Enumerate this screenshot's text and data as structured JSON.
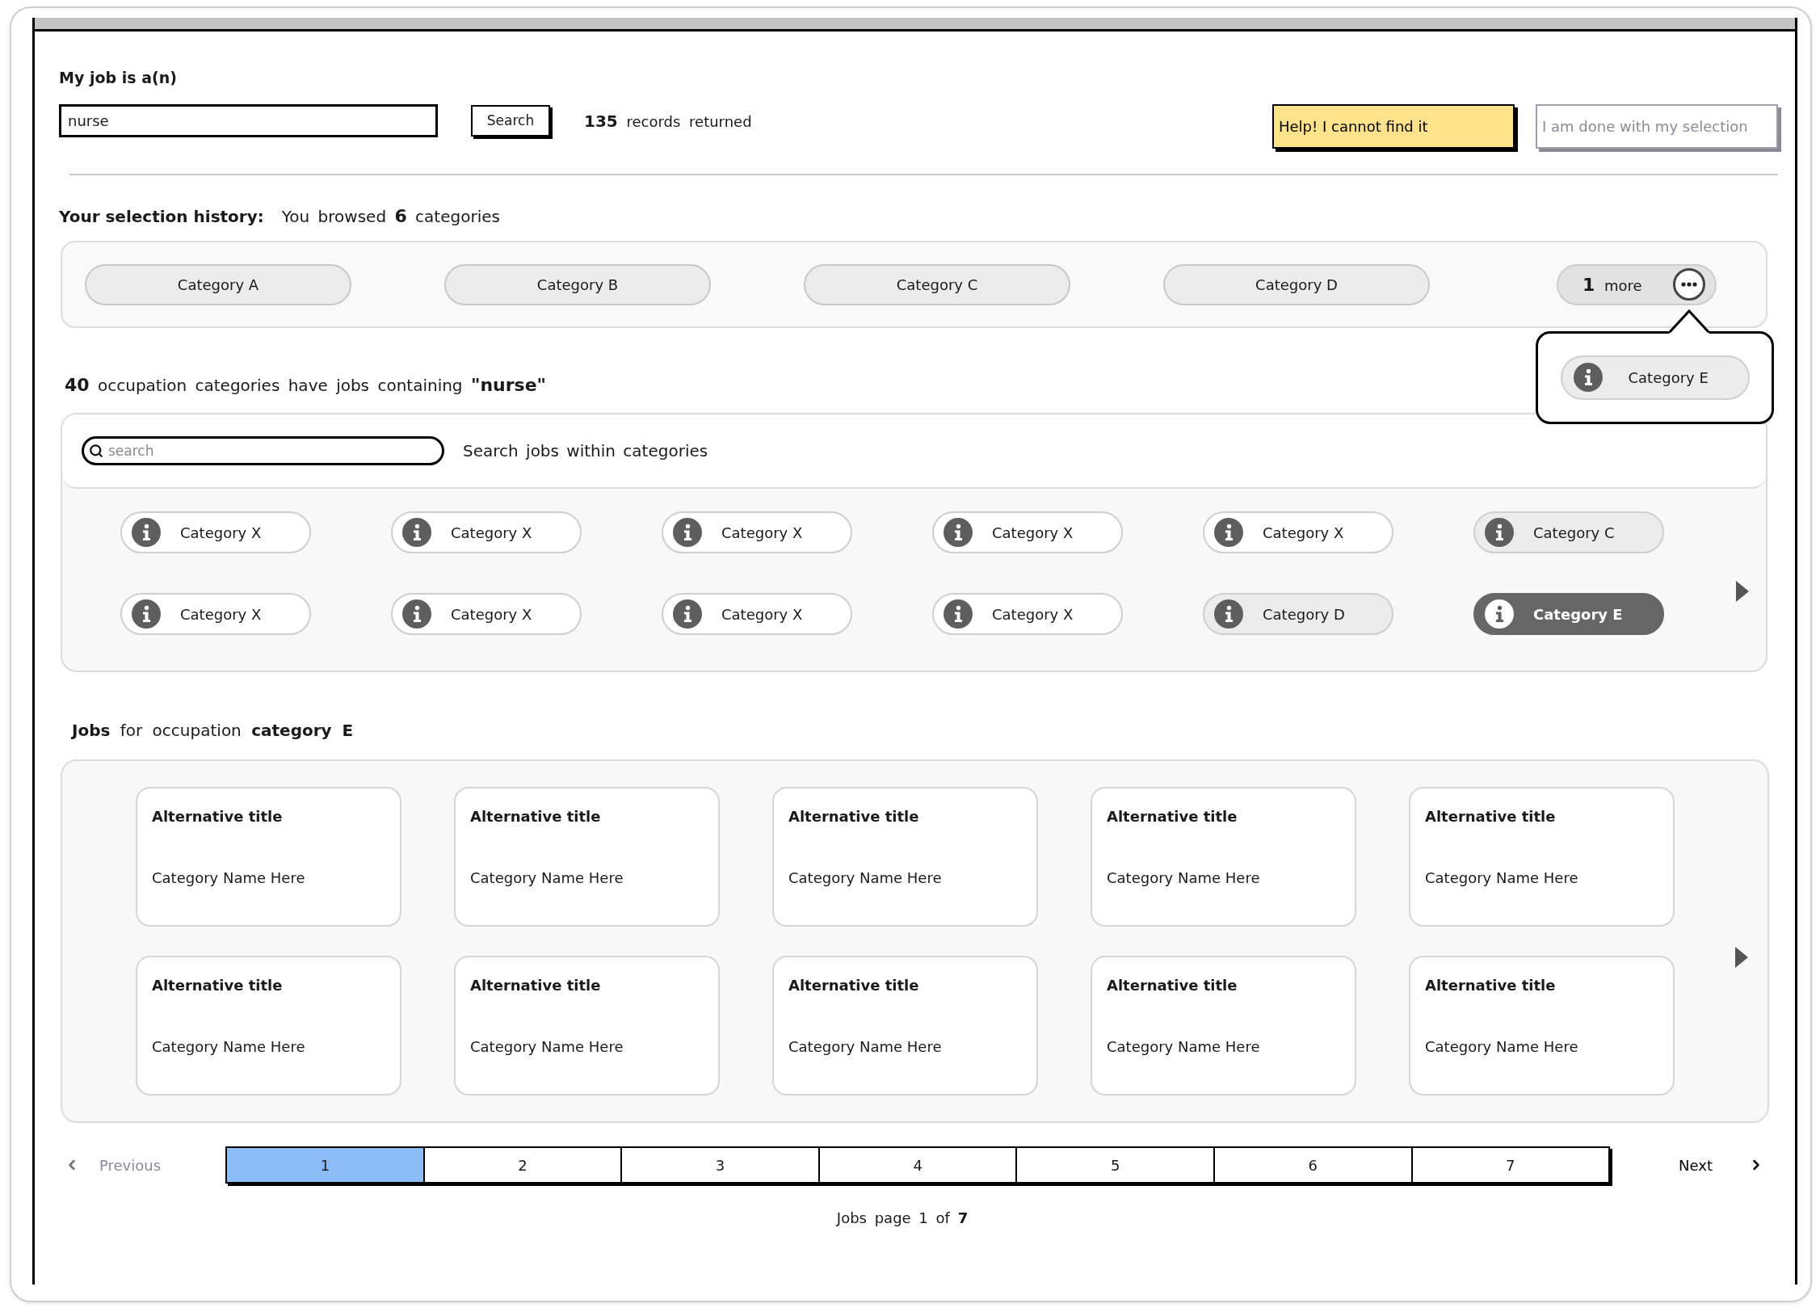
{
  "job_search": {
    "label": "My job is a(n)",
    "value": "nurse",
    "button": "Search",
    "result": "**135** records returned"
  },
  "actions": [
    {
      "label": "Help! I cannot find it",
      "kind": "highlight",
      "disabled": false
    },
    {
      "label": "I am done with my selection",
      "kind": "plain",
      "disabled": true
    }
  ],
  "history": {
    "title": "Your selection history:",
    "summary": "You browsed **6** categories",
    "items": [
      {
        "label": "Category A"
      },
      {
        "label": "Category B"
      },
      {
        "label": "Category C"
      },
      {
        "label": "Category D"
      }
    ],
    "more": {
      "label": "**1** more",
      "expanded": true
    },
    "popover_items": [
      {
        "label": "Category E"
      }
    ]
  },
  "categories": {
    "heading": "**40** occupation categories have jobs containing **\"nurse\"**",
    "search": {
      "placeholder": "search"
    },
    "search_label": "Search jobs within categories",
    "items": [
      {
        "label": "Category X",
        "visited": false,
        "selected": false
      },
      {
        "label": "Category X",
        "visited": false,
        "selected": false
      },
      {
        "label": "Category X",
        "visited": false,
        "selected": false
      },
      {
        "label": "Category X",
        "visited": false,
        "selected": false
      },
      {
        "label": "Category X",
        "visited": false,
        "selected": false
      },
      {
        "label": "Category C",
        "visited": true,
        "selected": false
      },
      {
        "label": "Category X",
        "visited": false,
        "selected": false
      },
      {
        "label": "Category X",
        "visited": false,
        "selected": false
      },
      {
        "label": "Category X",
        "visited": false,
        "selected": false
      },
      {
        "label": "Category X",
        "visited": false,
        "selected": false
      },
      {
        "label": "Category D",
        "visited": true,
        "selected": false
      },
      {
        "label": "Category E",
        "visited": true,
        "selected": true
      }
    ]
  },
  "jobs": {
    "heading": "**Jobs** for occupation **category E**",
    "cards": [
      {
        "title": "Alternative title",
        "category": "Category Name Here"
      },
      {
        "title": "Alternative title",
        "category": "Category Name Here"
      },
      {
        "title": "Alternative title",
        "category": "Category Name Here"
      },
      {
        "title": "Alternative title",
        "category": "Category Name Here"
      },
      {
        "title": "Alternative title",
        "category": "Category Name Here"
      },
      {
        "title": "Alternative title",
        "category": "Category Name Here"
      },
      {
        "title": "Alternative title",
        "category": "Category Name Here"
      },
      {
        "title": "Alternative title",
        "category": "Category Name Here"
      },
      {
        "title": "Alternative title",
        "category": "Category Name Here"
      },
      {
        "title": "Alternative title",
        "category": "Category Name Here"
      }
    ]
  },
  "pagination": {
    "previous": {
      "label": "Previous",
      "disabled": true
    },
    "pages": [
      {
        "label": "1",
        "selected": true
      },
      {
        "label": "2",
        "selected": false
      },
      {
        "label": "3",
        "selected": false
      },
      {
        "label": "4",
        "selected": false
      },
      {
        "label": "5",
        "selected": false
      },
      {
        "label": "6",
        "selected": false
      },
      {
        "label": "7",
        "selected": false
      }
    ],
    "next": {
      "label": "Next",
      "disabled": false
    },
    "summary": "Jobs page 1 of **7**"
  }
}
